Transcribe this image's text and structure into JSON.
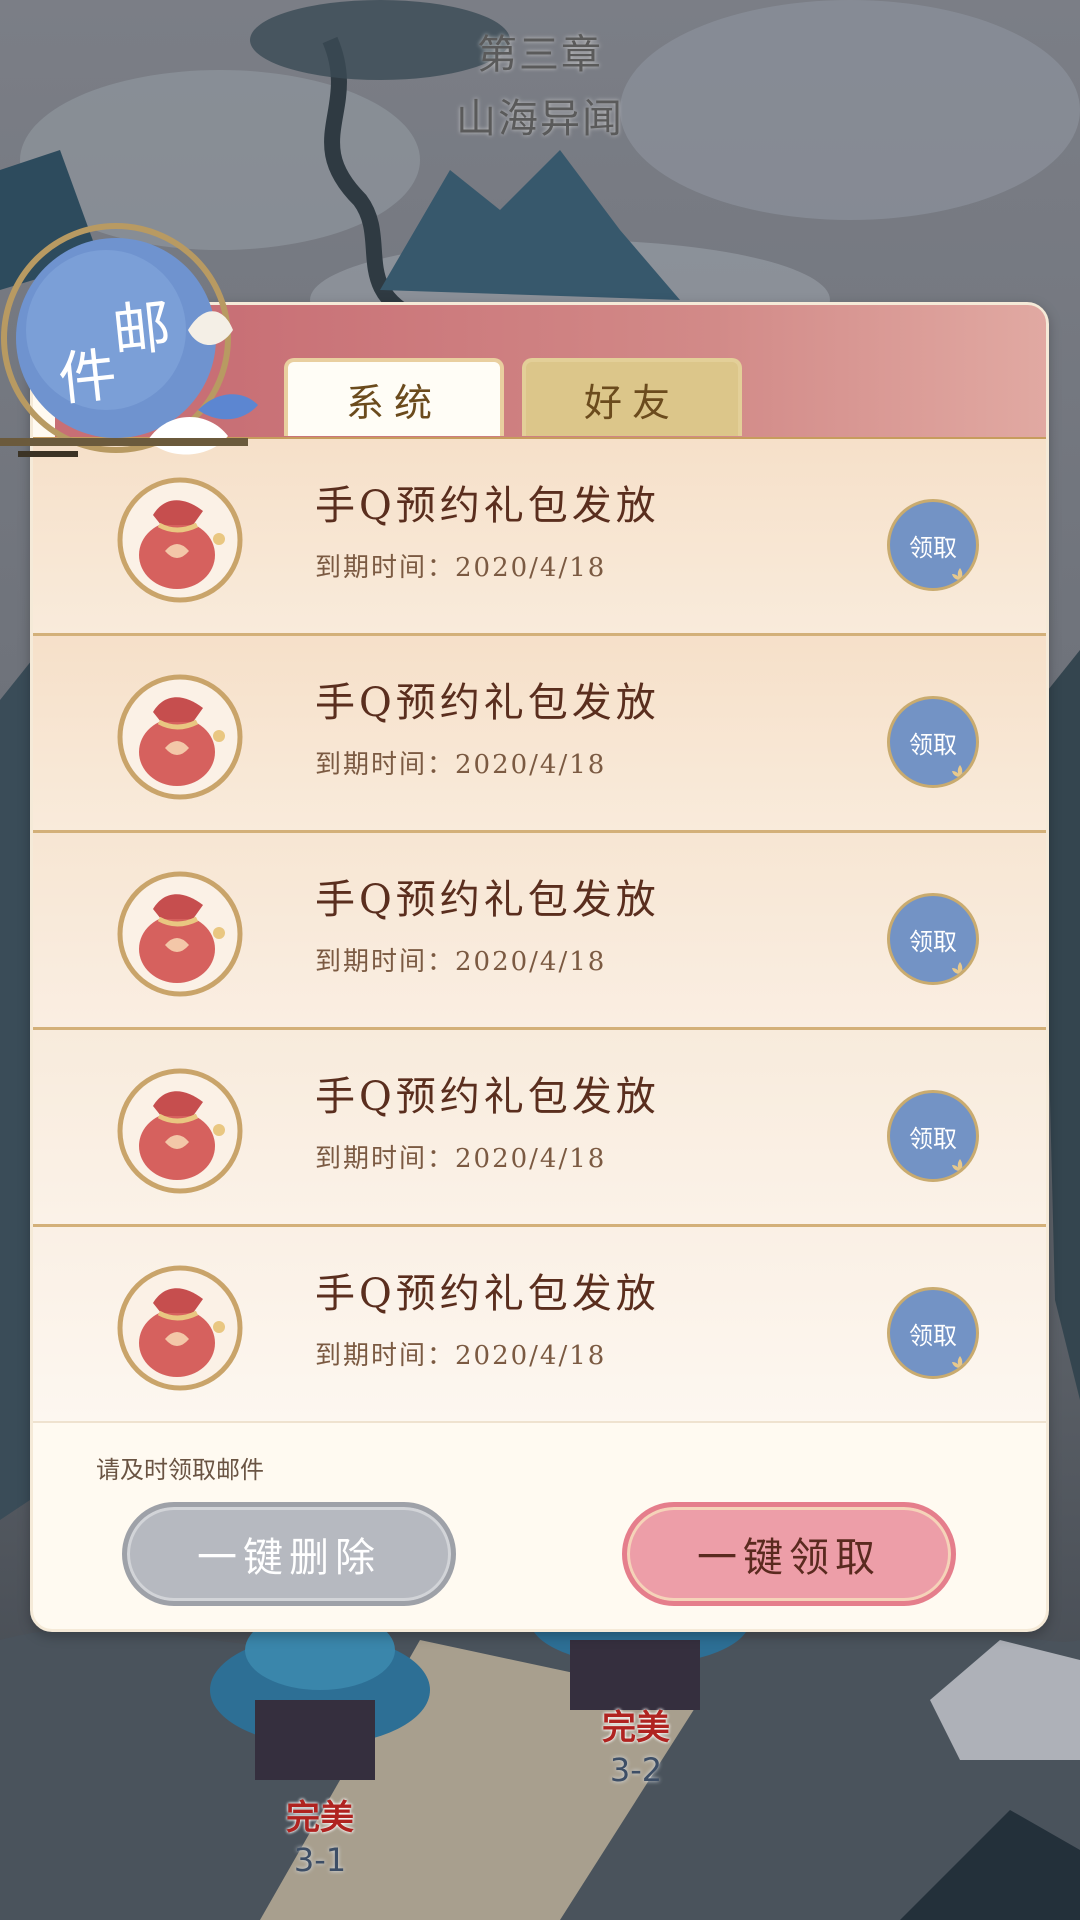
{
  "chapter": {
    "number": "第三章",
    "name": "山海异闻"
  },
  "mail": {
    "badge_chars": [
      "邮",
      "件"
    ],
    "tabs": [
      {
        "label": "系统",
        "active": true
      },
      {
        "label": "好友",
        "active": false
      }
    ],
    "items": [
      {
        "title": "手Q预约礼包发放",
        "expire": "到期时间：2020/4/18",
        "claim_label": "领取"
      },
      {
        "title": "手Q预约礼包发放",
        "expire": "到期时间：2020/4/18",
        "claim_label": "领取"
      },
      {
        "title": "手Q预约礼包发放",
        "expire": "到期时间：2020/4/18",
        "claim_label": "领取"
      },
      {
        "title": "手Q预约礼包发放",
        "expire": "到期时间：2020/4/18",
        "claim_label": "领取"
      },
      {
        "title": "手Q预约礼包发放",
        "expire": "到期时间：2020/4/18",
        "claim_label": "领取"
      }
    ],
    "hint": "请及时领取邮件",
    "delete_all_label": "一键删除",
    "claim_all_label": "一键领取"
  },
  "stages": [
    {
      "rating": "完美",
      "number": "3-1"
    },
    {
      "rating": "完美",
      "number": "3-2"
    }
  ],
  "colors": {
    "header": "#c86f75",
    "claim": "#7393c5",
    "claim_all": "#ed9ea8",
    "delete_all": "#b6b9c0"
  }
}
